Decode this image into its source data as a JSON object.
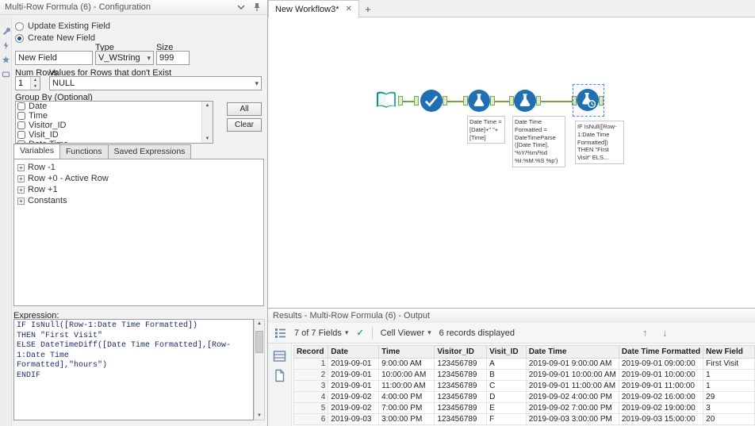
{
  "icons": {
    "close": "✕",
    "add": "+",
    "caret": "▾",
    "up": "↑",
    "down": "↓",
    "check": "✓",
    "spin_up": "▲",
    "spin_down": "▼",
    "expander": "+"
  },
  "config": {
    "title": "Multi-Row Formula (6) - Configuration",
    "radios": {
      "update": "Update Existing Field",
      "create": "Create New Field"
    },
    "field": {
      "value": "New Field",
      "type_label": "Type",
      "type": "V_WString",
      "size_label": "Size",
      "size": "999"
    },
    "num_rows": {
      "label": "Num Rows",
      "value": "1"
    },
    "values_rows": {
      "label": "Values for Rows that don't Exist",
      "value": "NULL"
    },
    "group_by": {
      "label": "Group By (Optional)",
      "items": [
        "Date",
        "Time",
        "Visitor_ID",
        "Visit_ID",
        "Date Time"
      ],
      "all": "All",
      "clear": "Clear"
    },
    "tabs": [
      "Variables",
      "Functions",
      "Saved Expressions"
    ],
    "tree": [
      "Row -1",
      "Row +0 - Active Row",
      "Row +1",
      "Constants"
    ],
    "expression": {
      "label": "Expression:",
      "text": "IF IsNull([Row-1:Date Time Formatted])\nTHEN \"First Visit\"\nELSE DateTimeDiff([Date Time Formatted],[Row-1:Date Time\nFormatted],\"hours\")\nENDIF"
    }
  },
  "canvas": {
    "tab": "New Workflow3*",
    "tools": [
      "text-input-tool",
      "select-tool",
      "formula-tool",
      "formula-tool",
      "multi-row-formula-tool"
    ],
    "annotations": [
      "Date Time = [Date]+\" \"+ [Time]",
      "Date Time Formatted = DateTimeParse ([Date Time], '%Y/%m/%d %I:%M:%S %p')",
      "IF IsNull([Row-1:Date Time Formatted]) THEN \"First Visit\" ELS..."
    ]
  },
  "results": {
    "title": "Results - Multi-Row Formula (6) - Output",
    "fields_dropdown": "7 of 7 Fields",
    "cell_viewer": "Cell Viewer",
    "records_text": "6 records displayed",
    "columns": [
      "Record",
      "Date",
      "Time",
      "Visitor_ID",
      "Visit_ID",
      "Date Time",
      "Date Time Formatted",
      "New Field"
    ],
    "rows": [
      [
        "1",
        "2019-09-01",
        "9:00:00 AM",
        "123456789",
        "A",
        "2019-09-01 9:00:00 AM",
        "2019-09-01 09:00:00",
        "First Visit"
      ],
      [
        "2",
        "2019-09-01",
        "10:00:00 AM",
        "123456789",
        "B",
        "2019-09-01 10:00:00 AM",
        "2019-09-01 10:00:00",
        "1"
      ],
      [
        "3",
        "2019-09-01",
        "11:00:00 AM",
        "123456789",
        "C",
        "2019-09-01 11:00:00 AM",
        "2019-09-01 11:00:00",
        "1"
      ],
      [
        "4",
        "2019-09-02",
        "4:00:00 PM",
        "123456789",
        "D",
        "2019-09-02 4:00:00 PM",
        "2019-09-02 16:00:00",
        "29"
      ],
      [
        "5",
        "2019-09-02",
        "7:00:00 PM",
        "123456789",
        "E",
        "2019-09-02 7:00:00 PM",
        "2019-09-02 19:00:00",
        "3"
      ],
      [
        "6",
        "2019-09-03",
        "3:00:00 PM",
        "123456789",
        "F",
        "2019-09-03 3:00:00 PM",
        "2019-09-03 15:00:00",
        "20"
      ]
    ]
  },
  "colors": {
    "tool_blue": "#1f6fb2",
    "connector_green": "#74a33c",
    "anchor_fill": "#dcead0",
    "accent_teal": "#2a9d8f"
  }
}
